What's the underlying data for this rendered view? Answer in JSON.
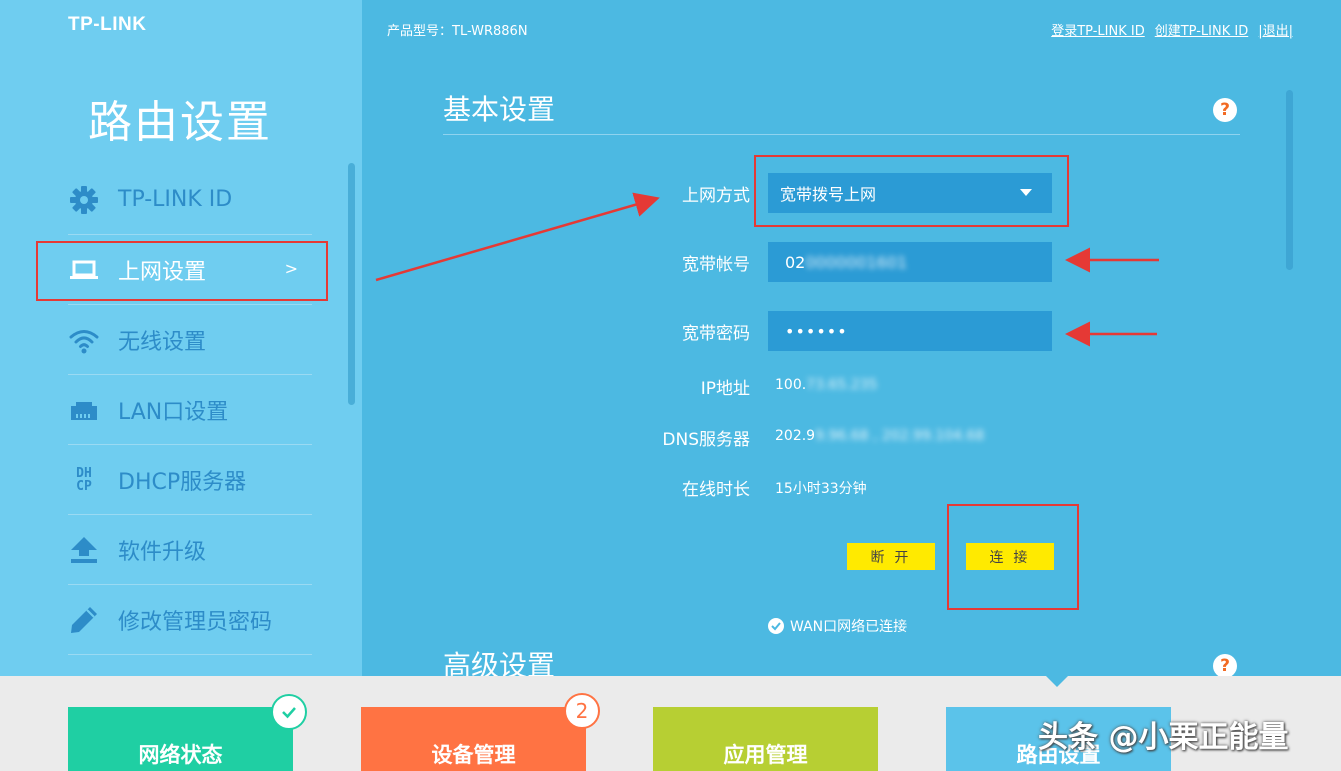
{
  "brand": "TP-LINK",
  "header": {
    "model_label": "产品型号：TL-WR886N",
    "links": [
      "登录TP-LINK ID",
      "创建TP-LINK ID",
      "|退出|"
    ]
  },
  "sidebar": {
    "title": "路由设置",
    "items": [
      {
        "label": "TP-LINK ID",
        "icon": "gear-icon"
      },
      {
        "label": "上网设置",
        "icon": "laptop-icon",
        "chevron": ">"
      },
      {
        "label": "无线设置",
        "icon": "wifi-icon"
      },
      {
        "label": "LAN口设置",
        "icon": "lan-port-icon"
      },
      {
        "label": "DHCP服务器",
        "icon": "dhcp-icon",
        "icon_text_top": "DH",
        "icon_text_bottom": "CP"
      },
      {
        "label": "软件升级",
        "icon": "upload-icon"
      },
      {
        "label": "修改管理员密码",
        "icon": "pencil-icon"
      }
    ]
  },
  "basic": {
    "title": "基本设置",
    "help": "?",
    "wan_mode_label": "上网方式",
    "wan_mode_value": "宽带拨号上网",
    "account_label": "宽带帐号",
    "account_value": "02",
    "account_blurred": "0000001601",
    "password_label": "宽带密码",
    "password_value": "••••••",
    "ip_label": "IP地址",
    "ip_value": "100.",
    "ip_blurred": "73.65.235",
    "dns_label": "DNS服务器",
    "dns_value": "202.9",
    "dns_blurred": "9.96.68 , 202.99.104.68",
    "uptime_label": "在线时长",
    "uptime_value": "15小时33分钟",
    "disconnect_label": "断 开",
    "connect_label": "连 接",
    "status_text": "WAN口网络已连接"
  },
  "advanced": {
    "title": "高级设置",
    "help": "?"
  },
  "bottom_tabs": [
    {
      "label": "网络状态",
      "color": "#1fcfa3"
    },
    {
      "label": "设备管理",
      "color": "#ff7343",
      "badge": "2"
    },
    {
      "label": "应用管理",
      "color": "#b7cf33"
    },
    {
      "label": "路由设置",
      "color": "#5bc3ea"
    }
  ],
  "watermark": "头条 @小栗正能量",
  "colors": {
    "annotation": "#e53935",
    "button": "#ffea00",
    "field": "#2b9bd5"
  }
}
